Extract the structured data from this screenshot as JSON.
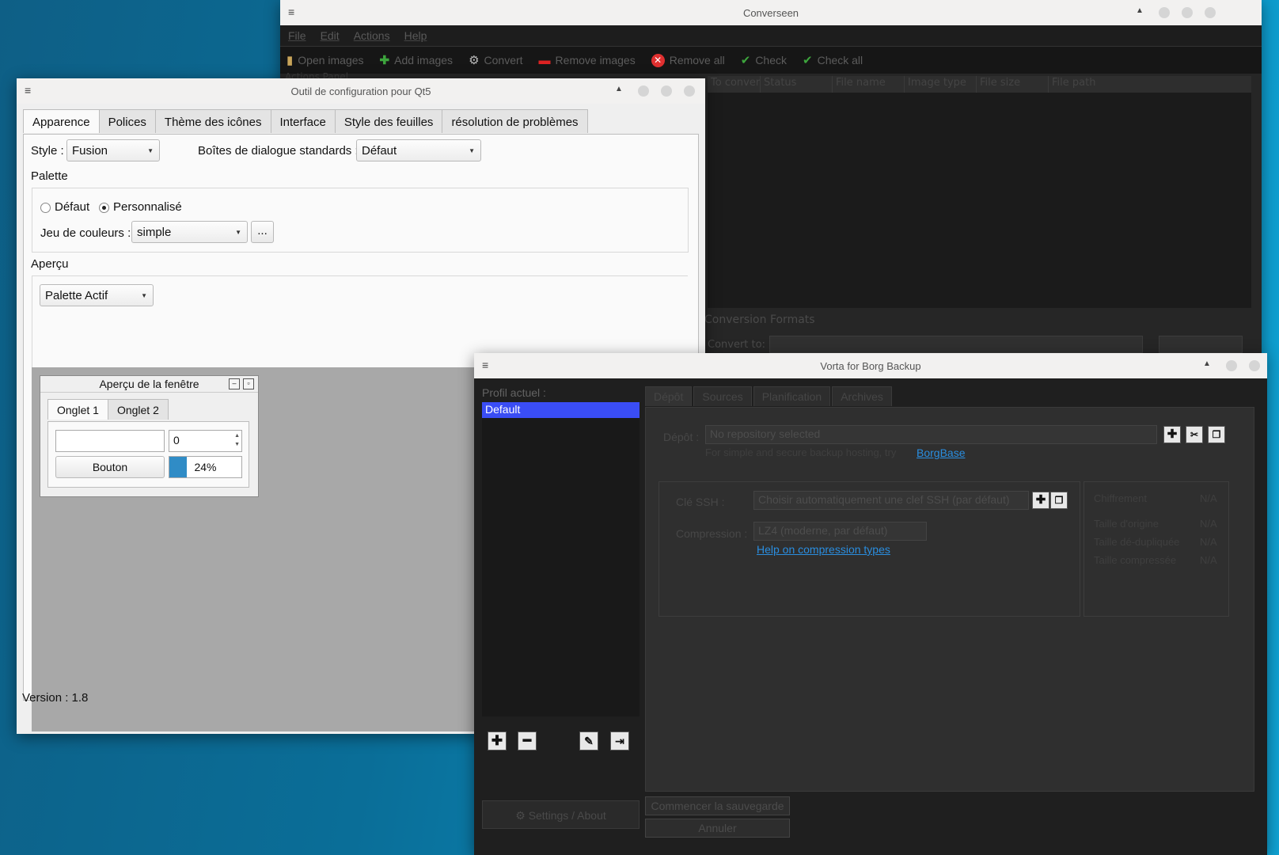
{
  "converseen": {
    "title": "Converseen",
    "menu": [
      "File",
      "Edit",
      "Actions",
      "Help"
    ],
    "toolbar": [
      {
        "label": "Open images",
        "icon": "folder-icon"
      },
      {
        "label": "Add images",
        "icon": "plus-icon"
      },
      {
        "label": "Convert",
        "icon": "gear-icon"
      },
      {
        "label": "Remove images",
        "icon": "minus-icon"
      },
      {
        "label": "Remove all",
        "icon": "remove-icon"
      },
      {
        "label": "Check",
        "icon": "check-icon"
      },
      {
        "label": "Check all",
        "icon": "check-icon"
      }
    ],
    "panel_label": "Actions Panel",
    "columns": [
      "To convert",
      "Status",
      "File name",
      "Image type",
      "File size",
      "File path"
    ],
    "formats_label": "Conversion Formats",
    "convert_to_label": "Convert to:",
    "colors": {
      "bg": "#262626",
      "toolbar": "#161616"
    }
  },
  "qt5ct": {
    "title": "Outil de configuration pour Qt5",
    "tabs": [
      "Apparence",
      "Polices",
      "Thème des icônes",
      "Interface",
      "Style des feuilles",
      "résolution de problèmes"
    ],
    "style_label": "Style :",
    "style_value": "Fusion",
    "dialogs_label": "Boîtes de dialogue standards :",
    "dialogs_value": "Défaut",
    "palette_label": "Palette",
    "radio_default": "Défaut",
    "radio_custom": "Personnalisé",
    "color_scheme_label": "Jeu de couleurs :",
    "color_scheme_value": "simple",
    "more_button": "...",
    "preview_label": "Aperçu",
    "palette_combo": "Palette  Actif",
    "preview_window": {
      "title": "Aperçu de la fenêtre",
      "tabs": [
        "Onglet 1",
        "Onglet 2"
      ],
      "spin_value": "0",
      "button": "Bouton",
      "progress_text": "24%",
      "progress": 0.24
    },
    "version": "Version : 1.8"
  },
  "vorta": {
    "title": "Vorta for Borg Backup",
    "profile_label": "Profil actuel :",
    "profiles": [
      "Default"
    ],
    "settings_button": "Settings / About",
    "tabs": [
      "Dépôt",
      "Sources",
      "Planification",
      "Archives"
    ],
    "repo_label": "Dépôt :",
    "repo_placeholder": "No repository selected",
    "hosting_text": "For simple and secure backup hosting, try",
    "hosting_link": "BorgBase",
    "ssh_label": "Clé SSH :",
    "ssh_value": "Choisir automatiquement une clef SSH (par défaut)",
    "compression_label": "Compression :",
    "compression_value": "LZ4 (moderne, par défaut)",
    "compression_link": "Help on compression types",
    "stats": [
      {
        "label": "Chiffrement",
        "value": "N/A"
      },
      {
        "label": "Taille d'origine",
        "value": "N/A"
      },
      {
        "label": "Taille dé-dupliquée",
        "value": "N/A"
      },
      {
        "label": "Taille compressée",
        "value": "N/A"
      }
    ],
    "start_button": "Commencer la sauvegarde",
    "cancel_button": "Annuler",
    "colors": {
      "selection": "#3a4df5",
      "link": "#2a8ee0"
    }
  }
}
